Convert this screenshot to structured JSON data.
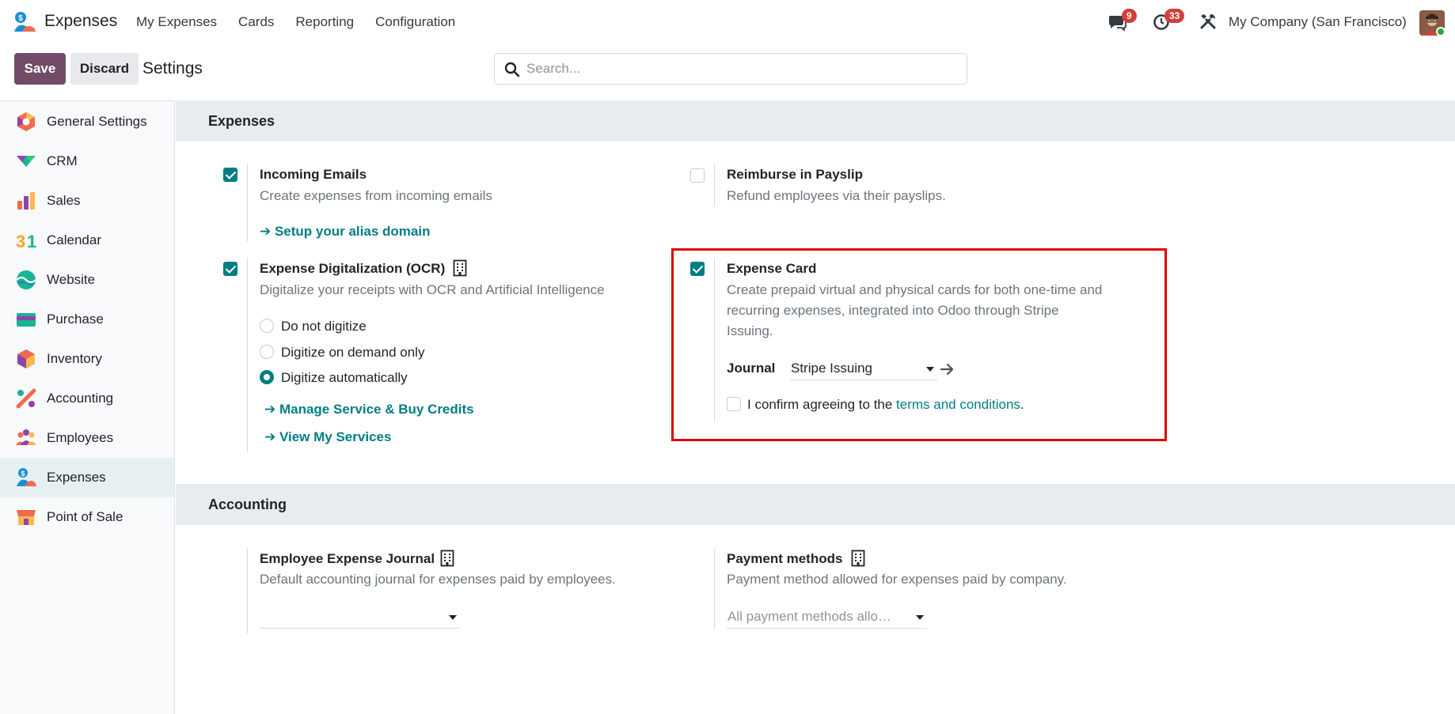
{
  "navbar": {
    "app_name": "Expenses",
    "menu": [
      "My Expenses",
      "Cards",
      "Reporting",
      "Configuration"
    ],
    "chat_count": "9",
    "activity_count": "33",
    "company": "My Company (San Francisco)"
  },
  "control_panel": {
    "save_label": "Save",
    "discard_label": "Discard",
    "title": "Settings",
    "search_placeholder": "Search..."
  },
  "sidebar": {
    "items": [
      {
        "label": "General Settings",
        "icon": "general-settings-icon"
      },
      {
        "label": "CRM",
        "icon": "crm-icon"
      },
      {
        "label": "Sales",
        "icon": "sales-icon"
      },
      {
        "label": "Calendar",
        "icon": "calendar-icon"
      },
      {
        "label": "Website",
        "icon": "website-icon"
      },
      {
        "label": "Purchase",
        "icon": "purchase-icon"
      },
      {
        "label": "Inventory",
        "icon": "inventory-icon"
      },
      {
        "label": "Accounting",
        "icon": "accounting-icon"
      },
      {
        "label": "Employees",
        "icon": "employees-icon"
      },
      {
        "label": "Expenses",
        "icon": "expenses-icon",
        "active": true
      },
      {
        "label": "Point of Sale",
        "icon": "point-of-sale-icon"
      }
    ]
  },
  "expenses_section": {
    "title": "Expenses",
    "incoming_emails": {
      "title": "Incoming Emails",
      "desc": "Create expenses from incoming emails",
      "link": "➔ Setup your alias domain",
      "checked": true
    },
    "reimburse_payslip": {
      "title": "Reimburse in Payslip",
      "desc": "Refund employees via their payslips.",
      "checked": false
    },
    "ocr": {
      "title": "Expense Digitalization (OCR)",
      "desc": "Digitalize your receipts with OCR and Artificial Intelligence",
      "checked": true,
      "options": [
        "Do not digitize",
        "Digitize on demand only",
        "Digitize automatically"
      ],
      "selected": "Digitize automatically",
      "link_credits": "➔ Manage Service & Buy Credits",
      "link_services": "➔ View My Services"
    },
    "expense_card": {
      "title": "Expense Card",
      "desc_1": "Create prepaid virtual and physical cards for both one-time and",
      "desc_2": "recurring expenses, integrated into Odoo through Stripe",
      "desc_3": "Issuing.",
      "checked": true,
      "journal_label": "Journal",
      "journal_value": "Stripe Issuing",
      "confirm_prefix": "I confirm agreeing to the ",
      "confirm_link": "terms and conditions",
      "confirm_suffix": ".",
      "confirm_checked": false
    }
  },
  "accounting_section": {
    "title": "Accounting",
    "employee_journal": {
      "title": "Employee Expense Journal",
      "desc": "Default accounting journal for expenses paid by employees.",
      "value": ""
    },
    "payment_methods": {
      "title": "Payment methods",
      "desc": "Payment method allowed for expenses paid by company.",
      "placeholder": "All payment methods allo…"
    }
  },
  "colors": {
    "brand": "#714b67",
    "accent": "#017e84",
    "highlight": "#e00000"
  }
}
